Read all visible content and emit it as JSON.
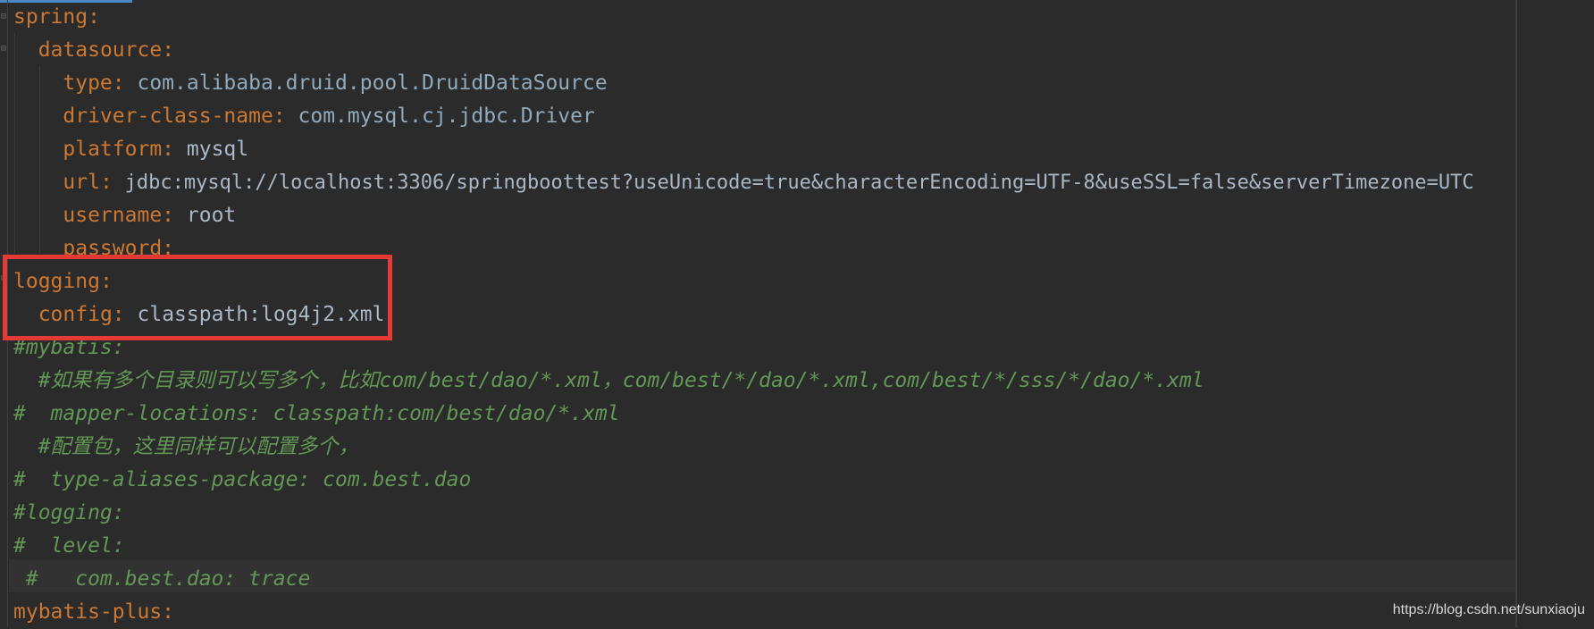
{
  "editor": {
    "lines": [
      {
        "indent": "",
        "key": "spring",
        "sep": ":",
        "value": ""
      },
      {
        "indent": "  ",
        "key": "datasource",
        "sep": ":",
        "value": ""
      },
      {
        "indent": "    ",
        "key": "type",
        "sep": ": ",
        "value": "com.alibaba.druid.pool.DruidDataSource"
      },
      {
        "indent": "    ",
        "key": "driver-class-name",
        "sep": ": ",
        "value": "com.mysql.cj.jdbc.Driver"
      },
      {
        "indent": "    ",
        "key": "platform",
        "sep": ": ",
        "value": "mysql"
      },
      {
        "indent": "    ",
        "key": "url",
        "sep": ": ",
        "value": "jdbc:mysql://localhost:3306/springboottest?useUnicode=true&characterEncoding=UTF-8&useSSL=false&serverTimezone=UTC"
      },
      {
        "indent": "    ",
        "key": "username",
        "sep": ": ",
        "value": "root"
      },
      {
        "indent": "    ",
        "key": "password",
        "sep": ":",
        "value": ""
      },
      {
        "indent": "",
        "key": "logging",
        "sep": ":",
        "value": ""
      },
      {
        "indent": "  ",
        "key": "config",
        "sep": ": ",
        "value": "classpath:log4j2.xml"
      },
      {
        "comment": "#mybatis:"
      },
      {
        "comment": "  #如果有多个目录则可以写多个，比如com/best/dao/*.xml，com/best/*/dao/*.xml,com/best/*/sss/*/dao/*.xml"
      },
      {
        "comment": "#  mapper-locations: classpath:com/best/dao/*.xml"
      },
      {
        "comment": "  #配置包，这里同样可以配置多个，"
      },
      {
        "comment": "#  type-aliases-package: com.best.dao"
      },
      {
        "comment": "#logging:"
      },
      {
        "comment": "#  level:"
      },
      {
        "comment": " #   com.best.dao: trace"
      },
      {
        "indent": "",
        "key": "mybatis-plus",
        "sep": ":",
        "value": ""
      }
    ]
  },
  "watermark": "https://blog.csdn.net/sunxiaoju",
  "colors": {
    "background": "#2b2b2b",
    "key": "#cc7832",
    "value": "#a9b7c6",
    "class_value": "#6897bb",
    "comment": "#629755",
    "highlight_box": "#e53935"
  },
  "icons": {
    "fold": "fold-marker-icon"
  }
}
